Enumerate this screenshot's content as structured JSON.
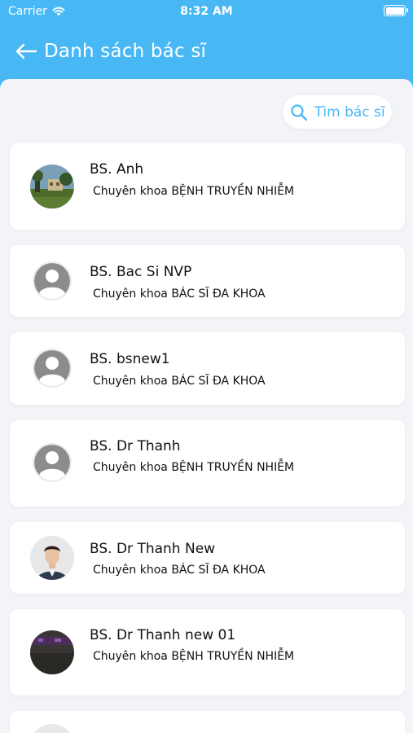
{
  "status_bar": {
    "carrier": "Carrier",
    "time": "8:32 AM"
  },
  "header": {
    "title": "Danh sách bác sĩ"
  },
  "search": {
    "label": "Tìm bác sĩ"
  },
  "doctors": [
    {
      "name": "BS. Anh",
      "specialty": "Chuyên khoa BỆNH TRUYỀN NHIỄM",
      "avatar": "photo-landscape"
    },
    {
      "name": "BS. Bac Si NVP",
      "specialty": "Chuyên khoa BÁC SĨ ĐA KHOA",
      "avatar": "default-user-icon"
    },
    {
      "name": "BS. bsnew1",
      "specialty": "Chuyên khoa BÁC SĨ ĐA KHOA",
      "avatar": "default-user-icon"
    },
    {
      "name": "BS. Dr Thanh",
      "specialty": "Chuyên khoa BỆNH TRUYỀN NHIỄM",
      "avatar": "default-user-icon"
    },
    {
      "name": "BS. Dr Thanh New",
      "specialty": "Chuyên khoa BÁC SĨ ĐA KHOA",
      "avatar": "photo-person"
    },
    {
      "name": "BS. Dr Thanh new 01",
      "specialty": "Chuyên khoa BỆNH TRUYỀN NHIỄM",
      "avatar": "photo-dark-room"
    }
  ],
  "colors": {
    "accent": "#48b8f5",
    "background": "#f2f4f7",
    "card": "#ffffff"
  }
}
